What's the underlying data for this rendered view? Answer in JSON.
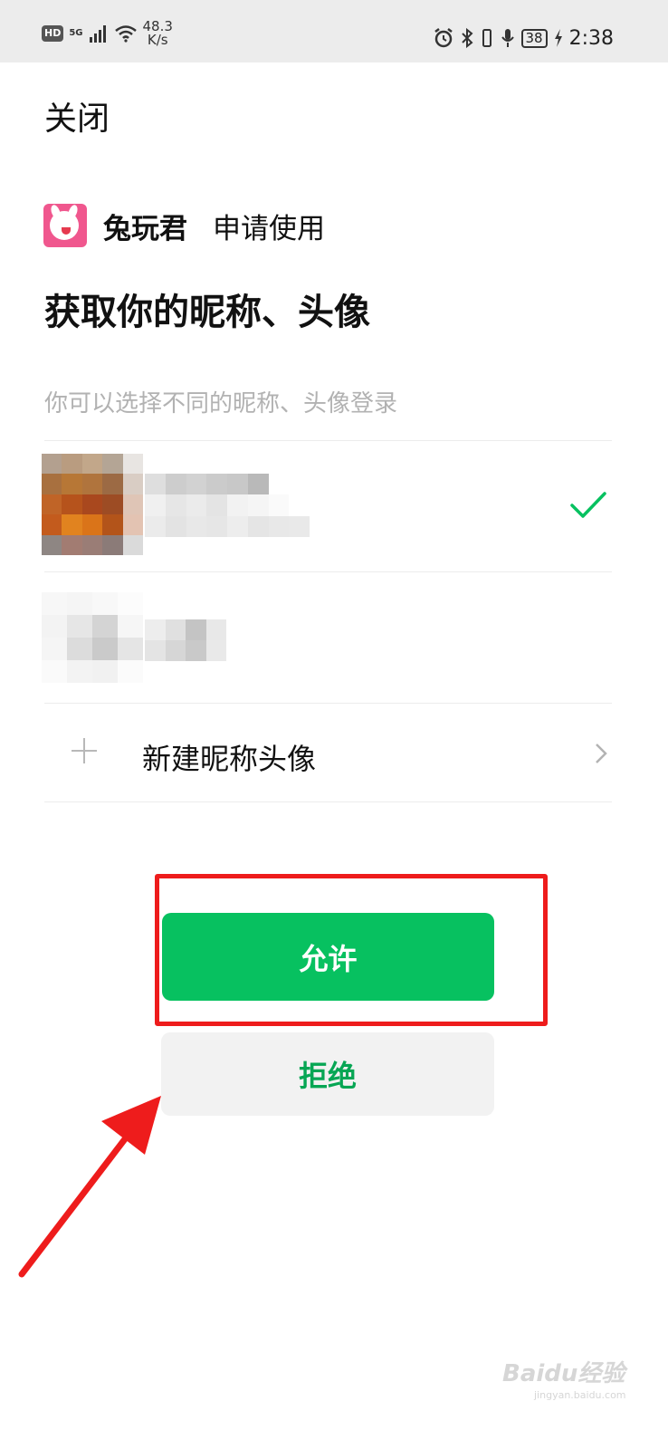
{
  "status_bar": {
    "hd": "HD",
    "network": "5G",
    "speed_value": "48.3",
    "speed_unit": "K/s",
    "battery": "38",
    "time": "2:38"
  },
  "header": {
    "close_label": "关闭"
  },
  "app": {
    "name": "兔玩君",
    "request_text": "申请使用"
  },
  "title": "获取你的昵称、头像",
  "subtitle": "你可以选择不同的昵称、头像登录",
  "accounts": [
    {
      "selected": true,
      "blurred": true
    },
    {
      "selected": false,
      "blurred": true
    }
  ],
  "new_profile": {
    "label": "新建昵称头像"
  },
  "buttons": {
    "allow": "允许",
    "deny": "拒绝"
  },
  "colors": {
    "accent_green": "#07c160",
    "highlight_red": "#ee1c1c"
  },
  "watermark": {
    "text": "Baidu经验",
    "sub": "jingyan.baidu.com"
  }
}
